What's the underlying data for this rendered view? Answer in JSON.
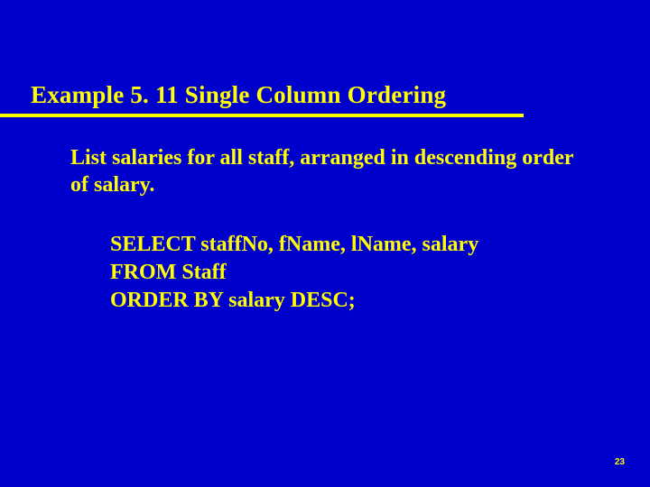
{
  "title": "Example 5. 11  Single Column Ordering",
  "description": "List salaries for all staff, arranged in descending order of salary.",
  "sql": {
    "line1": "SELECT staffNo, fName, lName, salary",
    "line2": "FROM Staff",
    "line3": "ORDER BY salary DESC;"
  },
  "page_number": "23"
}
